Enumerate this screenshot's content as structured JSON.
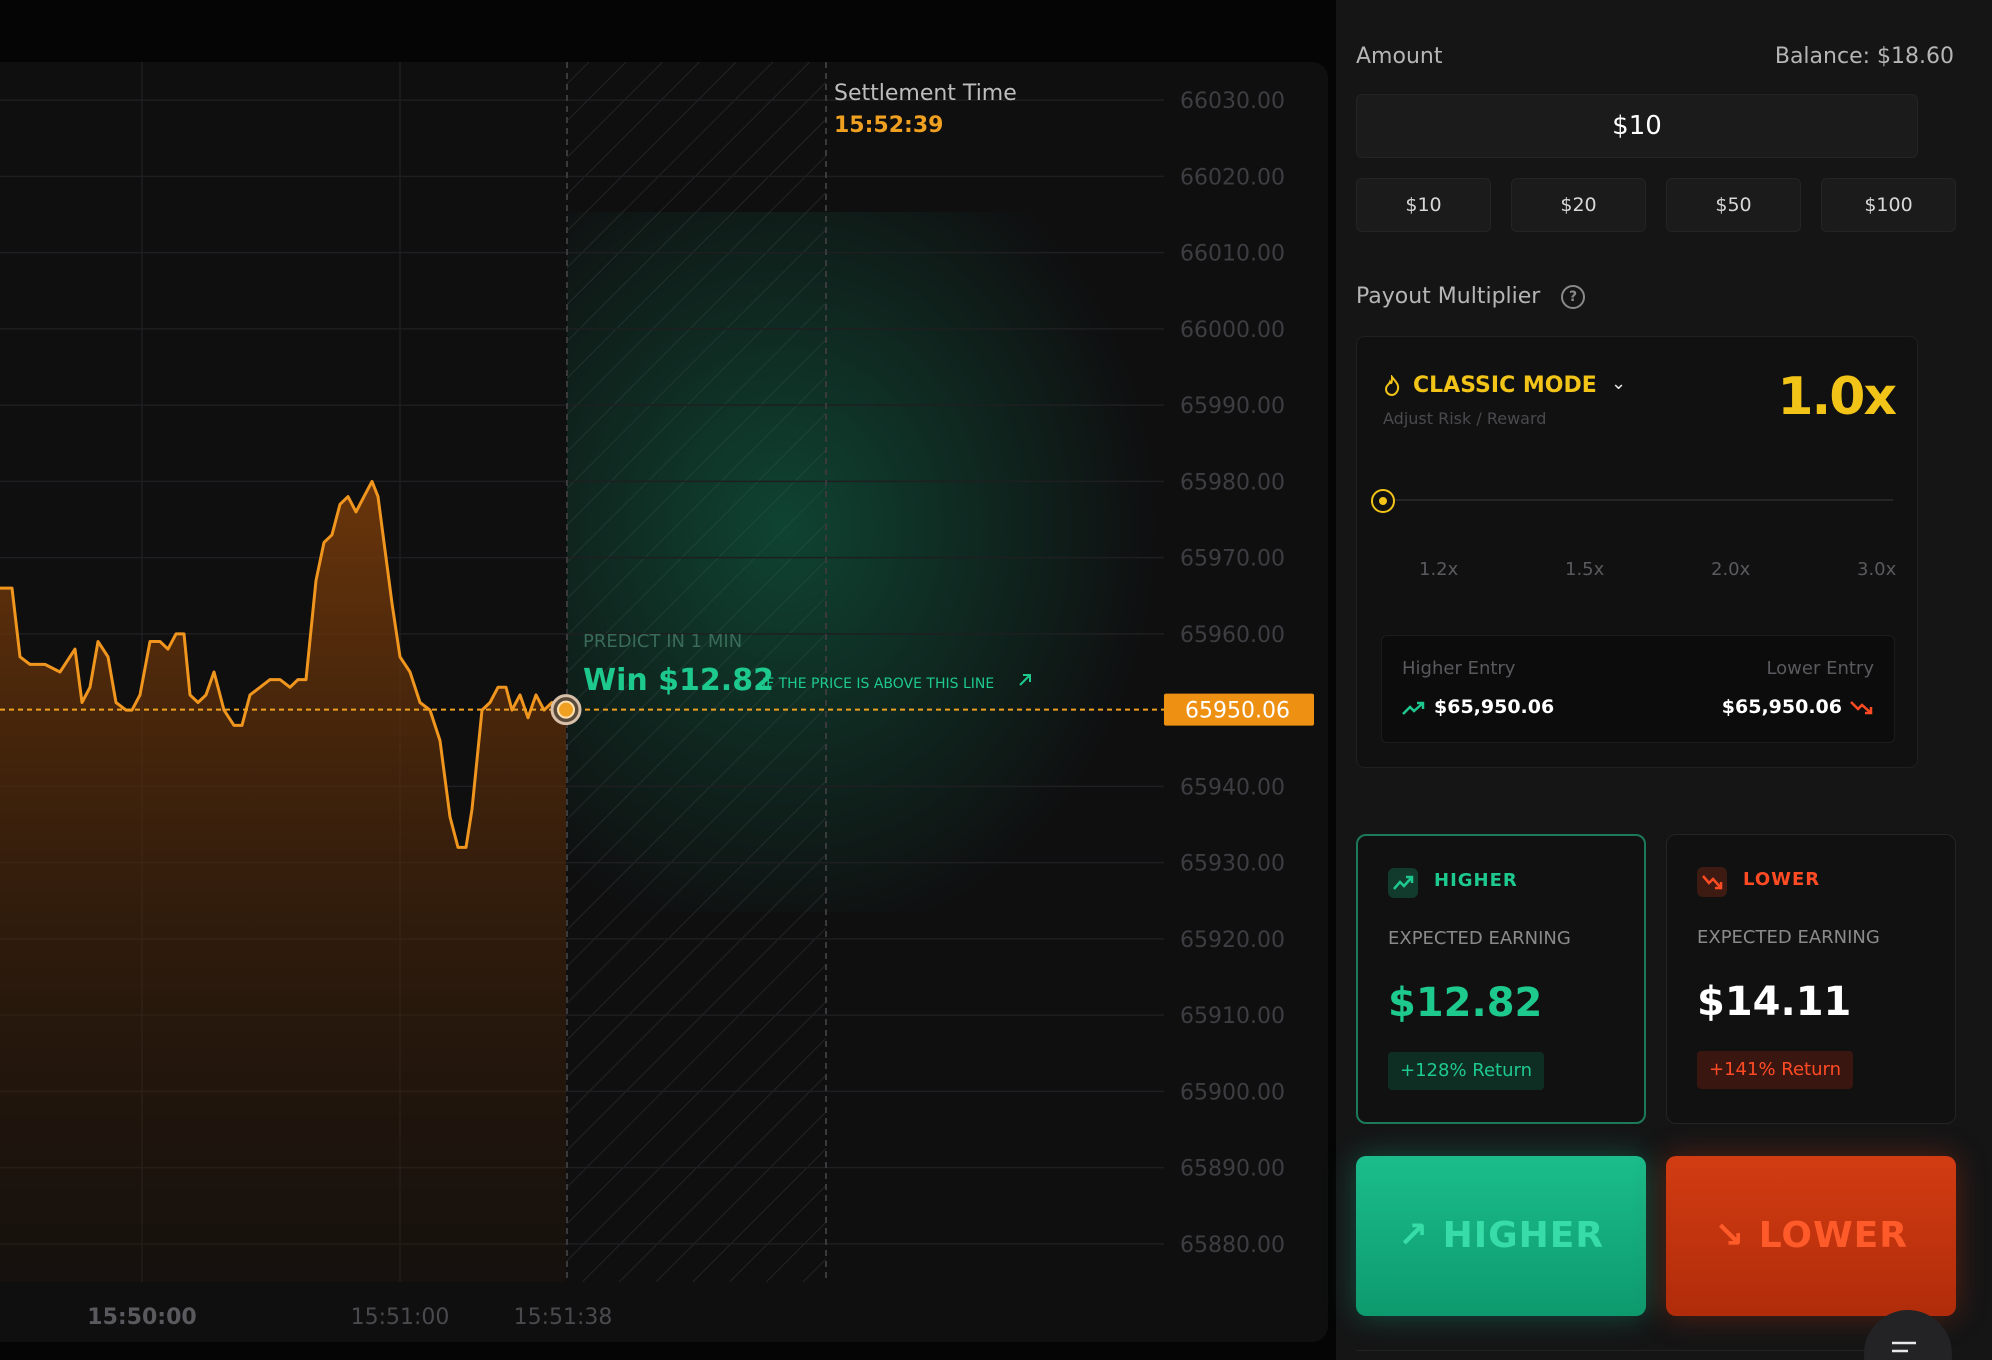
{
  "chart": {
    "settlement_label": "Settlement Time",
    "settlement_time": "15:52:39",
    "predict_label": "PREDICT IN 1 MIN",
    "win_text": "Win $12.82",
    "win_sub": "IF THE PRICE IS ABOVE THIS LINE",
    "current_price_tag": "65950.06",
    "colors": {
      "line": "#f0961e",
      "accent_green": "#1ec98e",
      "tag": "#ee9112"
    }
  },
  "chart_data": {
    "type": "area",
    "title": "",
    "xlabel": "",
    "ylabel": "",
    "ylim": [
      65875,
      66035
    ],
    "y_ticks": [
      "66030.00",
      "66020.00",
      "66010.00",
      "66000.00",
      "65990.00",
      "65980.00",
      "65970.00",
      "65960.00",
      "65950.06",
      "65940.00",
      "65930.00",
      "65920.00",
      "65910.00",
      "65900.00",
      "65890.00",
      "65880.00"
    ],
    "x_ticks": [
      "15:50:00",
      "15:51:00",
      "15:51:38"
    ],
    "series": [
      {
        "points": [
          [
            0,
            65966
          ],
          [
            12,
            65966
          ],
          [
            20,
            65957
          ],
          [
            30,
            65956
          ],
          [
            45,
            65956
          ],
          [
            60,
            65955
          ],
          [
            75,
            65958
          ],
          [
            82,
            65951
          ],
          [
            90,
            65953
          ],
          [
            98,
            65959
          ],
          [
            108,
            65957
          ],
          [
            116,
            65951
          ],
          [
            126,
            65950
          ],
          [
            132,
            65950
          ],
          [
            140,
            65952
          ],
          [
            150,
            65959
          ],
          [
            160,
            65959
          ],
          [
            168,
            65958
          ],
          [
            176,
            65960
          ],
          [
            184,
            65960
          ],
          [
            190,
            65952
          ],
          [
            198,
            65951
          ],
          [
            206,
            65952
          ],
          [
            214,
            65955
          ],
          [
            224,
            65950
          ],
          [
            234,
            65948
          ],
          [
            242,
            65948
          ],
          [
            250,
            65952
          ],
          [
            260,
            65953
          ],
          [
            270,
            65954
          ],
          [
            280,
            65954
          ],
          [
            290,
            65953
          ],
          [
            298,
            65954
          ],
          [
            306,
            65954
          ],
          [
            316,
            65967
          ],
          [
            324,
            65972
          ],
          [
            332,
            65973
          ],
          [
            340,
            65977
          ],
          [
            348,
            65978
          ],
          [
            356,
            65976
          ],
          [
            364,
            65978
          ],
          [
            372,
            65980
          ],
          [
            378,
            65978
          ],
          [
            384,
            65972
          ],
          [
            392,
            65964
          ],
          [
            400,
            65957
          ],
          [
            410,
            65955
          ],
          [
            420,
            65951
          ],
          [
            430,
            65950
          ],
          [
            440,
            65946
          ],
          [
            450,
            65936
          ],
          [
            458,
            65932
          ],
          [
            466,
            65932
          ],
          [
            472,
            65937
          ],
          [
            482,
            65950
          ],
          [
            490,
            65951
          ],
          [
            498,
            65953
          ],
          [
            506,
            65953
          ],
          [
            512,
            65950
          ],
          [
            520,
            65952
          ],
          [
            528,
            65949
          ],
          [
            536,
            65952
          ],
          [
            544,
            65950
          ],
          [
            552,
            65951
          ],
          [
            566,
            65950.06
          ]
        ]
      }
    ],
    "current_price": 65950.06,
    "grid": true
  },
  "sidebar": {
    "amount_label": "Amount",
    "balance_label": "Balance: $18.60",
    "amount_value": "$10",
    "chips": [
      "$10",
      "$20",
      "$50",
      "$100"
    ],
    "payout_label": "Payout Multiplier",
    "help_icon": "?",
    "mode": {
      "title": "CLASSIC MODE",
      "subtitle": "Adjust Risk / Reward",
      "multiplier": "1.0x",
      "slider_value": 1.0,
      "marks": [
        "1.2x",
        "1.5x",
        "2.0x",
        "3.0x"
      ],
      "higher_entry_label": "Higher Entry",
      "higher_entry_value": "$65,950.06",
      "lower_entry_label": "Lower Entry",
      "lower_entry_value": "$65,950.06"
    },
    "higher_card": {
      "title": "HIGHER",
      "subtitle": "EXPECTED EARNING",
      "value": "$12.82",
      "badge": "+128% Return",
      "color": "#1ec98e"
    },
    "lower_card": {
      "title": "LOWER",
      "subtitle": "EXPECTED EARNING",
      "value": "$14.11",
      "badge": "+141% Return",
      "color": "#ff4b24"
    },
    "higher_button": "HIGHER",
    "lower_button": "LOWER"
  }
}
